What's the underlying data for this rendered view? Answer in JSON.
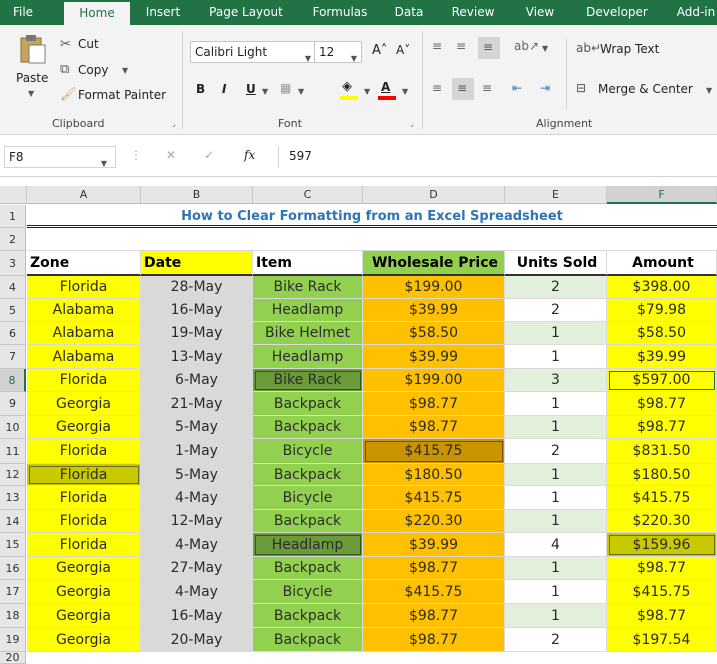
{
  "tabs": [
    "File",
    "Home",
    "Insert",
    "Page Layout",
    "Formulas",
    "Data",
    "Review",
    "View",
    "Developer",
    "Add-in"
  ],
  "active_tab": "Home",
  "clipboard": {
    "paste": "Paste",
    "cut": "Cut",
    "copy": "Copy",
    "format_painter": "Format Painter",
    "group": "Clipboard"
  },
  "font": {
    "name": "Calibri Light",
    "size": "12",
    "bold": "B",
    "italic": "I",
    "underline": "U",
    "grow": "A˄",
    "shrink": "A˅",
    "color_letter": "A",
    "group": "Font"
  },
  "alignment": {
    "wrap_text": "Wrap Text",
    "merge_center": "Merge & Center",
    "group": "Alignment"
  },
  "formula_bar": {
    "name_box": "F8",
    "fx": "fx",
    "value": "597"
  },
  "columns": [
    "A",
    "B",
    "C",
    "D",
    "E",
    "F"
  ],
  "selected_column": "F",
  "rows": [
    "1",
    "2",
    "3",
    "4",
    "5",
    "6",
    "7",
    "8",
    "9",
    "10",
    "11",
    "12",
    "13",
    "14",
    "15",
    "16",
    "17",
    "18",
    "19",
    "20"
  ],
  "selected_row": "8",
  "sheet": {
    "title": "How to Clear Formatting from an Excel Spreadsheet",
    "headers": [
      "Zone",
      "Date",
      "Item",
      "Wholesale Price",
      "Units Sold",
      "Amount"
    ],
    "records": [
      [
        "Florida",
        "28-May",
        "Bike Rack",
        "$199.00",
        "2",
        "$398.00"
      ],
      [
        "Alabama",
        "16-May",
        "Headlamp",
        "$39.99",
        "2",
        "$79.98"
      ],
      [
        "Alabama",
        "19-May",
        "Bike Helmet",
        "$58.50",
        "1",
        "$58.50"
      ],
      [
        "Alabama",
        "13-May",
        "Headlamp",
        "$39.99",
        "1",
        "$39.99"
      ],
      [
        "Florida",
        "6-May",
        "Bike Rack",
        "$199.00",
        "3",
        "$597.00"
      ],
      [
        "Georgia",
        "21-May",
        "Backpack",
        "$98.77",
        "1",
        "$98.77"
      ],
      [
        "Georgia",
        "5-May",
        "Backpack",
        "$98.77",
        "1",
        "$98.77"
      ],
      [
        "Florida",
        "1-May",
        "Bicycle",
        "$415.75",
        "2",
        "$831.50"
      ],
      [
        "Florida",
        "5-May",
        "Backpack",
        "$180.50",
        "1",
        "$180.50"
      ],
      [
        "Florida",
        "4-May",
        "Bicycle",
        "$415.75",
        "1",
        "$415.75"
      ],
      [
        "Florida",
        "12-May",
        "Backpack",
        "$220.30",
        "1",
        "$220.30"
      ],
      [
        "Florida",
        "4-May",
        "Headlamp",
        "$39.99",
        "4",
        "$159.96"
      ],
      [
        "Georgia",
        "27-May",
        "Backpack",
        "$98.77",
        "1",
        "$98.77"
      ],
      [
        "Georgia",
        "4-May",
        "Bicycle",
        "$415.75",
        "1",
        "$415.75"
      ],
      [
        "Georgia",
        "16-May",
        "Backpack",
        "$98.77",
        "1",
        "$98.77"
      ],
      [
        "Georgia",
        "20-May",
        "Backpack",
        "$98.77",
        "2",
        "$197.54"
      ]
    ]
  },
  "colors": {
    "ribbon_green": "#217346",
    "title_blue": "#2e75b6",
    "zone_fill": "#ffff00",
    "date_fill": "#d9d9d9",
    "item_fill": "#92d050",
    "price_fill": "#ffc000",
    "units_fill_alt": "#e2efda",
    "amount_fill": "#ffff00",
    "highlight_zone": "#c9c900",
    "highlight_item": "#6a9a3a",
    "highlight_price": "#c99400"
  }
}
